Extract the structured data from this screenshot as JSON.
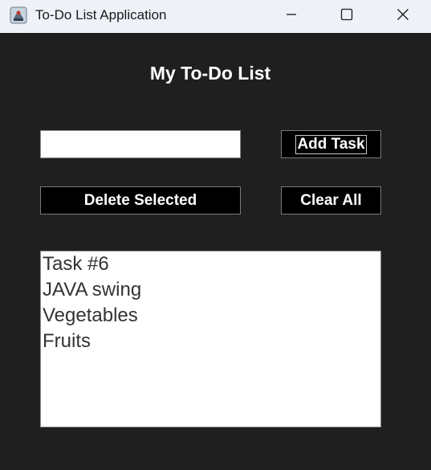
{
  "window": {
    "title": "To-Do List Application",
    "icon": "java-app-icon",
    "controls": {
      "minimize_icon": "minimize-icon",
      "maximize_icon": "maximize-icon",
      "close_icon": "close-icon"
    }
  },
  "main": {
    "heading": "My To-Do List",
    "task_input": {
      "value": "",
      "placeholder": ""
    },
    "add_button_label": "Add Task",
    "delete_button_label": "Delete Selected",
    "clear_button_label": "Clear All",
    "tasks": [
      "Task #6",
      "JAVA swing",
      "Vegetables",
      "Fruits"
    ]
  },
  "colors": {
    "background": "#1f1f1f",
    "titlebar": "#eef1f7",
    "button_bg": "#000000",
    "button_text": "#ffffff"
  }
}
